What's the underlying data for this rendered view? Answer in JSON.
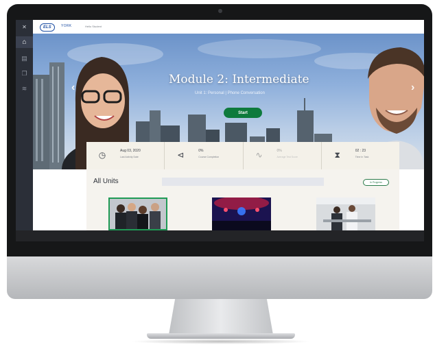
{
  "app": {
    "logo": "ELS",
    "logo_text": "YORK",
    "welcome_text": "Hello Student",
    "colors": {
      "accent": "#0e7a3c",
      "brand": "#1e4fa3",
      "sidebar": "#2b2f38"
    }
  },
  "sidebar": {
    "items": [
      {
        "icon": "close-icon",
        "glyph": "✕"
      },
      {
        "icon": "home-icon",
        "glyph": "⌂"
      },
      {
        "icon": "calendar-icon",
        "glyph": "▤"
      },
      {
        "icon": "documents-icon",
        "glyph": "❐"
      },
      {
        "icon": "layers-icon",
        "glyph": "≋"
      }
    ]
  },
  "hero": {
    "title": "Module 2: Intermediate",
    "subtitle": "Unit 1: Personal | Phone Conversation",
    "start_label": "Start",
    "prev_glyph": "‹",
    "next_glyph": "›"
  },
  "stats": [
    {
      "icon": "clock-icon",
      "glyph": "◷",
      "value": "Aug 03, 2020",
      "label": "Last Activity Date",
      "dim": false
    },
    {
      "icon": "megaphone-icon",
      "glyph": "⊲",
      "value": "0%",
      "label": "Course Completion",
      "dim": false
    },
    {
      "icon": "chart-icon",
      "glyph": "∿",
      "value": "0%",
      "label": "Average Test Score",
      "dim": true
    },
    {
      "icon": "hourglass-icon",
      "glyph": "⧗",
      "value": "02 : 23",
      "label": "Time In Task",
      "dim": false
    }
  ],
  "units": {
    "title": "All Units",
    "search_placeholder": "",
    "filter_label": "In Progress"
  }
}
